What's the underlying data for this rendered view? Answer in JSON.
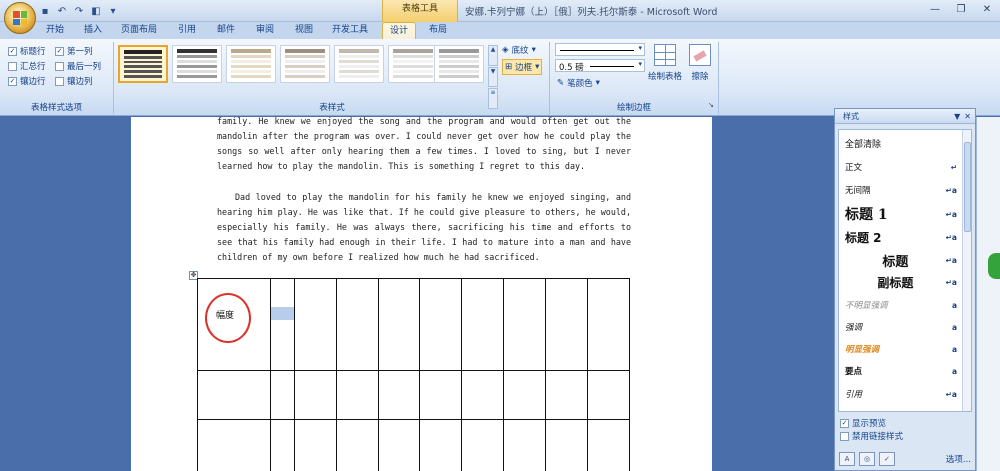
{
  "titlebar": {
    "contextual_tab_title": "表格工具",
    "doc_title": "安娜.卡列宁娜（上）［俄］列夫.托尔斯泰 - Microsoft Word",
    "qat_icons": [
      "save-icon",
      "undo-icon",
      "redo-icon",
      "print-preview-icon"
    ]
  },
  "tabs": [
    {
      "label": "开始"
    },
    {
      "label": "插入"
    },
    {
      "label": "页面布局"
    },
    {
      "label": "引用"
    },
    {
      "label": "邮件"
    },
    {
      "label": "审阅"
    },
    {
      "label": "视图"
    },
    {
      "label": "开发工具"
    },
    {
      "label": "设计",
      "active": true
    },
    {
      "label": "布局"
    }
  ],
  "ribbon": {
    "style_options": {
      "label": "表格样式选项",
      "items": [
        {
          "label": "标题行",
          "checked": true
        },
        {
          "label": "第一列",
          "checked": true
        },
        {
          "label": "汇总行",
          "checked": false
        },
        {
          "label": "最后一列",
          "checked": false
        },
        {
          "label": "镶边行",
          "checked": true
        },
        {
          "label": "镶边列",
          "checked": false
        }
      ]
    },
    "table_styles": {
      "label": "表样式"
    },
    "shading_label": "底纹",
    "borders_label": "边框",
    "draw_borders": {
      "label": "绘制边框",
      "line_weight": "0.5 磅",
      "pen_color_label": "笔颜色",
      "draw_table_label": "绘制表格",
      "eraser_label": "擦除"
    }
  },
  "document": {
    "paragraph1": "family. He knew we enjoyed the song and the program and would often get out the mandolin after the program was over. I could never get over how he could play the songs so well after only hearing them a few times. I loved to sing, but I never learned how to play the mandolin. This is something I regret to this day.",
    "paragraph2": "Dad loved to play the mandolin for his family he knew we enjoyed singing, and hearing him play. He was like that. If he could give pleasure to others, he would, especially his family. He was always there, sacrificing his time and efforts to see that his family had enough in their life. I had to mature into a man and have children of my own before I realized how much he had sacrificed.",
    "cell_text": "幅度"
  },
  "styles_pane": {
    "title": "样式",
    "items": [
      {
        "name": "全部清除",
        "mark": ""
      },
      {
        "name": "正文",
        "mark": "↵"
      },
      {
        "name": "无间隔",
        "mark": "↵a"
      },
      {
        "name": "标题 1",
        "mark": "↵a"
      },
      {
        "name": "标题 2",
        "mark": "↵a"
      },
      {
        "name": "标题",
        "mark": "↵a"
      },
      {
        "name": "副标题",
        "mark": "↵a"
      },
      {
        "name": "不明显强调",
        "mark": "a"
      },
      {
        "name": "强调",
        "mark": "a"
      },
      {
        "name": "明显强调",
        "mark": "a"
      },
      {
        "name": "要点",
        "mark": "a"
      },
      {
        "name": "引用",
        "mark": "↵a"
      }
    ],
    "show_preview_label": "显示预览",
    "disable_linked_label": "禁用链接样式",
    "show_preview_checked": true,
    "disable_linked_checked": false,
    "options_label": "选项..."
  }
}
